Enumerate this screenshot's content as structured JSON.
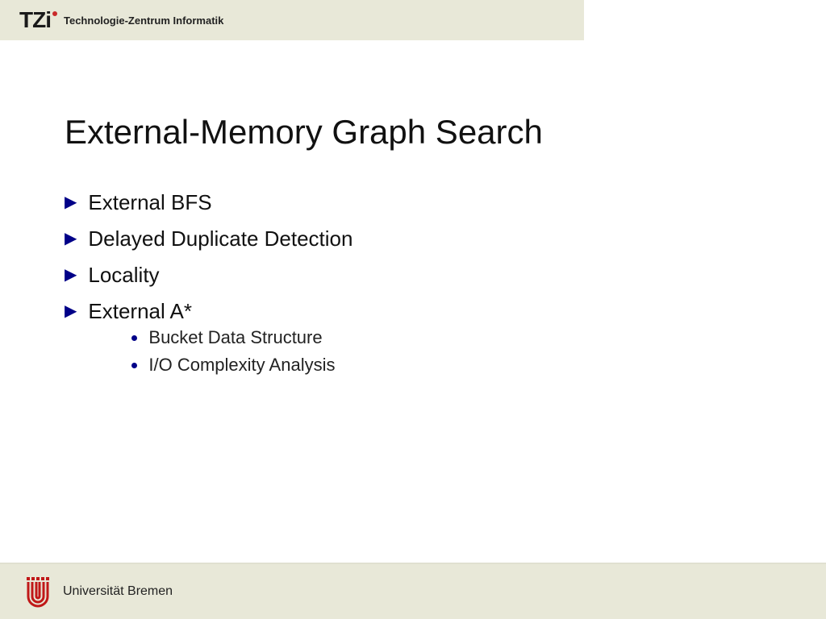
{
  "header": {
    "logo_text": "TZi",
    "org_name": "Technologie-Zentrum Informatik"
  },
  "slide": {
    "title": "External-Memory Graph Search",
    "bullets": [
      {
        "text": "External BFS",
        "sub": []
      },
      {
        "text": "Delayed Duplicate Detection",
        "sub": []
      },
      {
        "text": "Locality",
        "sub": []
      },
      {
        "text": "External A*",
        "sub": [
          "Bucket Data Structure",
          "I/O Complexity Analysis"
        ]
      }
    ]
  },
  "footer": {
    "university": "Universität Bremen"
  }
}
